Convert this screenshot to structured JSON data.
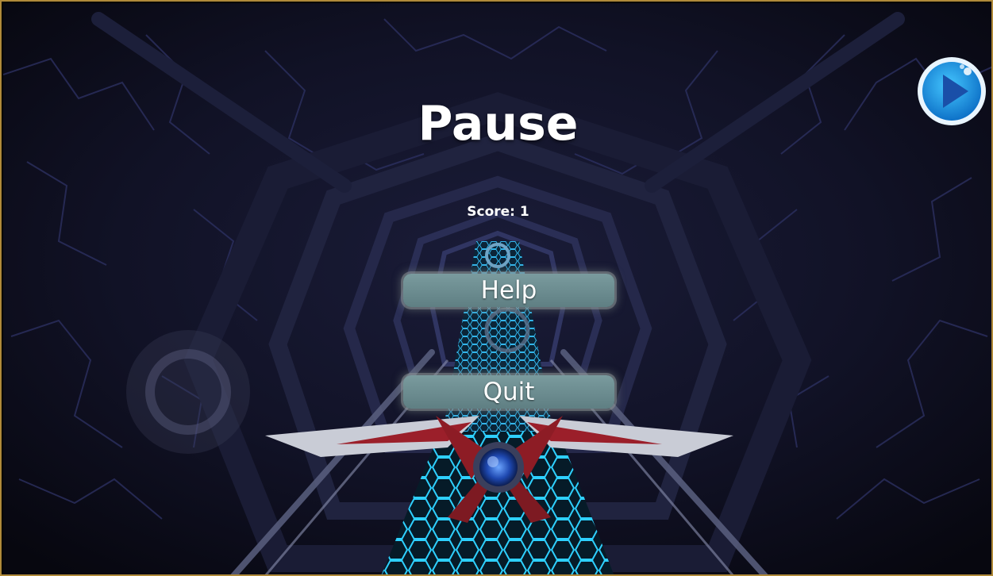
{
  "pause_menu": {
    "title": "Pause",
    "score_text": "Score: 1",
    "buttons": {
      "help": "Help",
      "quit": "Quit"
    }
  },
  "hud": {
    "resume_icon": "play-icon",
    "joystick_icon": "virtual-joystick"
  },
  "colors": {
    "button_fill": "#6b8b8e",
    "play_blue": "#1a6fc9",
    "floor_glow": "#19b7e6",
    "frame_border": "#b08a3a"
  }
}
